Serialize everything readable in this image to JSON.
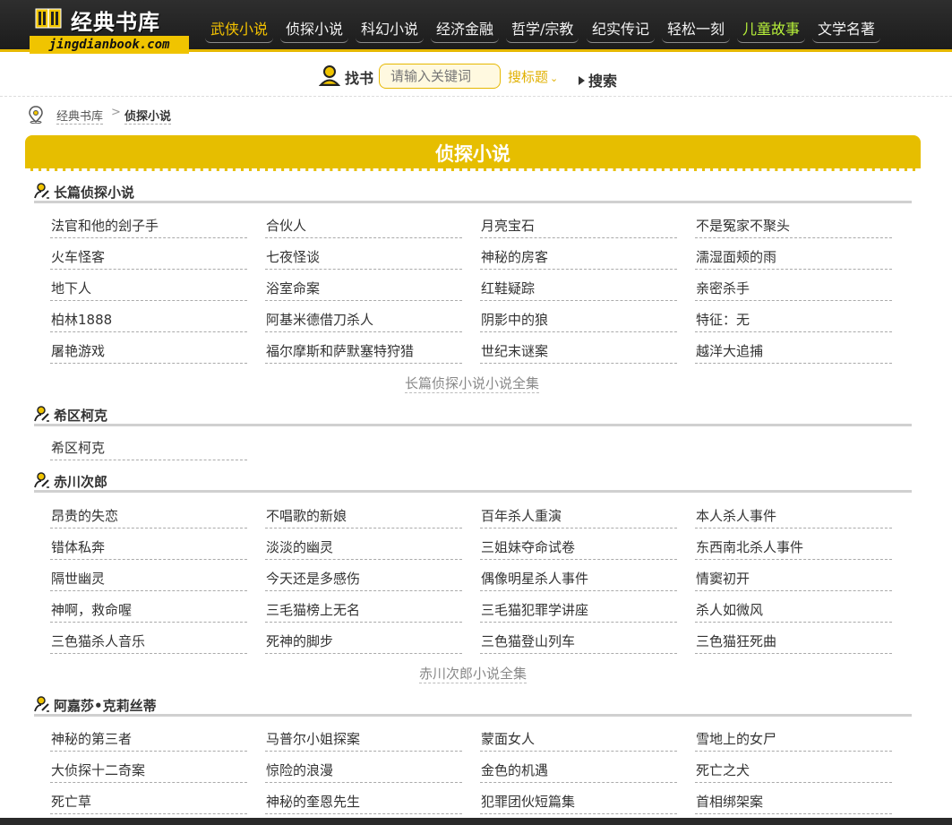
{
  "logo": {
    "name": "经典书库",
    "url": "jingdianbook.com"
  },
  "nav": [
    {
      "label": "武侠小说",
      "state": "active"
    },
    {
      "label": "侦探小说",
      "state": ""
    },
    {
      "label": "科幻小说",
      "state": ""
    },
    {
      "label": "经济金融",
      "state": ""
    },
    {
      "label": "哲学/宗教",
      "state": ""
    },
    {
      "label": "纪实传记",
      "state": ""
    },
    {
      "label": "轻松一刻",
      "state": ""
    },
    {
      "label": "儿童故事",
      "state": "green"
    },
    {
      "label": "文学名著",
      "state": ""
    }
  ],
  "search": {
    "label": "找书",
    "placeholder": "请输入关键词",
    "scope": "搜标题",
    "button": "搜索"
  },
  "breadcrumb": {
    "home": "经典书库",
    "separator": ">",
    "current": "侦探小说"
  },
  "page_title": "侦探小说",
  "sections": [
    {
      "title": "长篇侦探小说",
      "books": [
        "法官和他的刽子手",
        "合伙人",
        "月亮宝石",
        "不是冤家不聚头",
        "火车怪客",
        "七夜怪谈",
        "神秘的房客",
        "濡湿面颊的雨",
        "地下人",
        "浴室命案",
        "红鞋疑踪",
        "亲密杀手",
        "柏林1888",
        "阿基米德借刀杀人",
        "阴影中的狼",
        "特征：无",
        "屠艳游戏",
        "福尔摩斯和萨默塞特狩猎",
        "世纪末谜案",
        "越洋大追捕"
      ],
      "all_link": "长篇侦探小说小说全集"
    },
    {
      "title": "希区柯克",
      "books": [
        "希区柯克"
      ],
      "all_link": ""
    },
    {
      "title": "赤川次郎",
      "books": [
        "昂贵的失恋",
        "不唱歌的新娘",
        "百年杀人重演",
        "本人杀人事件",
        "错体私奔",
        "淡淡的幽灵",
        "三姐妹夺命试卷",
        "东西南北杀人事件",
        "隔世幽灵",
        "今天还是多感伤",
        "偶像明星杀人事件",
        "情窦初开",
        "神啊，救命喔",
        "三毛猫榜上无名",
        "三毛猫犯罪学讲座",
        "杀人如微风",
        "三色猫杀人音乐",
        "死神的脚步",
        "三色猫登山列车",
        "三色猫狂死曲"
      ],
      "all_link": "赤川次郎小说全集"
    },
    {
      "title": "阿嘉莎•克莉丝蒂",
      "books": [
        "神秘的第三者",
        "马普尔小姐探案",
        "蒙面女人",
        "雪地上的女尸",
        "大侦探十二奇案",
        "惊险的浪漫",
        "金色的机遇",
        "死亡之犬",
        "死亡草",
        "神秘的奎恩先生",
        "犯罪团伙短篇集",
        "首相绑架案"
      ],
      "all_link": ""
    }
  ],
  "colors": {
    "accent": "#e6be00",
    "header_bg": "#1c1c1c",
    "active_nav": "#f4c200",
    "highlight_nav": "#b8f23a"
  }
}
